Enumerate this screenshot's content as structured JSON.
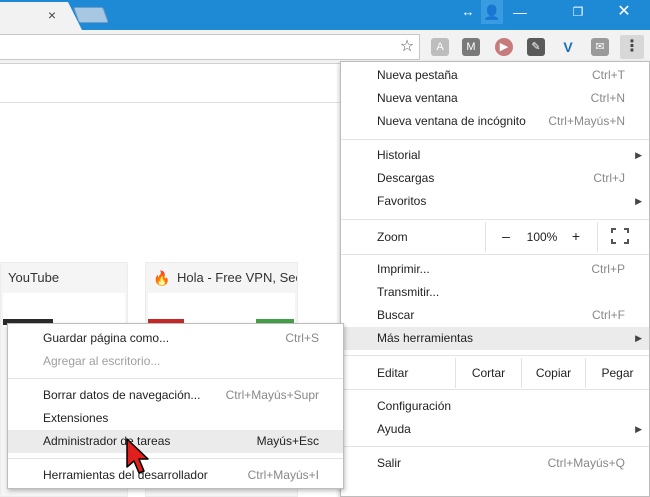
{
  "titlebar": {
    "tab_close": "×",
    "resize_glyph": "↔",
    "user_glyph": "👤",
    "minimize_glyph": "—",
    "maximize_glyph": "❐",
    "close_glyph": "✕"
  },
  "toolbar": {
    "star_glyph": "☆",
    "menu_glyph": "⋮",
    "extensions": [
      "pdf-icon",
      "m-icon",
      "play-icon",
      "evernote-icon",
      "v-icon",
      "inbox-icon"
    ]
  },
  "tiles": [
    {
      "title": "YouTube"
    },
    {
      "title": "Hola - Free VPN, Sec"
    }
  ],
  "main_menu": {
    "items": [
      {
        "label": "Nueva pestaña",
        "shortcut": "Ctrl+T"
      },
      {
        "label": "Nueva ventana",
        "shortcut": "Ctrl+N"
      },
      {
        "label": "Nueva ventana de incógnito",
        "shortcut": "Ctrl+Mayús+N"
      },
      {
        "label": "Historial",
        "shortcut": ""
      },
      {
        "label": "Descargas",
        "shortcut": "Ctrl+J"
      },
      {
        "label": "Favoritos",
        "shortcut": ""
      },
      {
        "label": "Imprimir...",
        "shortcut": "Ctrl+P"
      },
      {
        "label": "Transmitir...",
        "shortcut": ""
      },
      {
        "label": "Buscar",
        "shortcut": "Ctrl+F"
      },
      {
        "label": "Más herramientas",
        "shortcut": ""
      },
      {
        "label": "Configuración",
        "shortcut": ""
      },
      {
        "label": "Ayuda",
        "shortcut": ""
      },
      {
        "label": "Salir",
        "shortcut": "Ctrl+Mayús+Q"
      }
    ],
    "zoom": {
      "label": "Zoom",
      "minus": "–",
      "value": "100%",
      "plus": "+"
    },
    "edit": {
      "label": "Editar",
      "cut": "Cortar",
      "copy": "Copiar",
      "paste": "Pegar"
    }
  },
  "sub_menu": {
    "items": [
      {
        "label": "Guardar página como...",
        "shortcut": "Ctrl+S"
      },
      {
        "label": "Agregar al escritorio...",
        "shortcut": ""
      },
      {
        "label": "Borrar datos de navegación...",
        "shortcut": "Ctrl+Mayús+Supr"
      },
      {
        "label": "Extensiones",
        "shortcut": ""
      },
      {
        "label": "Administrador de tareas",
        "shortcut": "Mayús+Esc"
      },
      {
        "label": "Herramientas del desarrollador",
        "shortcut": "Ctrl+Mayús+I"
      }
    ]
  }
}
